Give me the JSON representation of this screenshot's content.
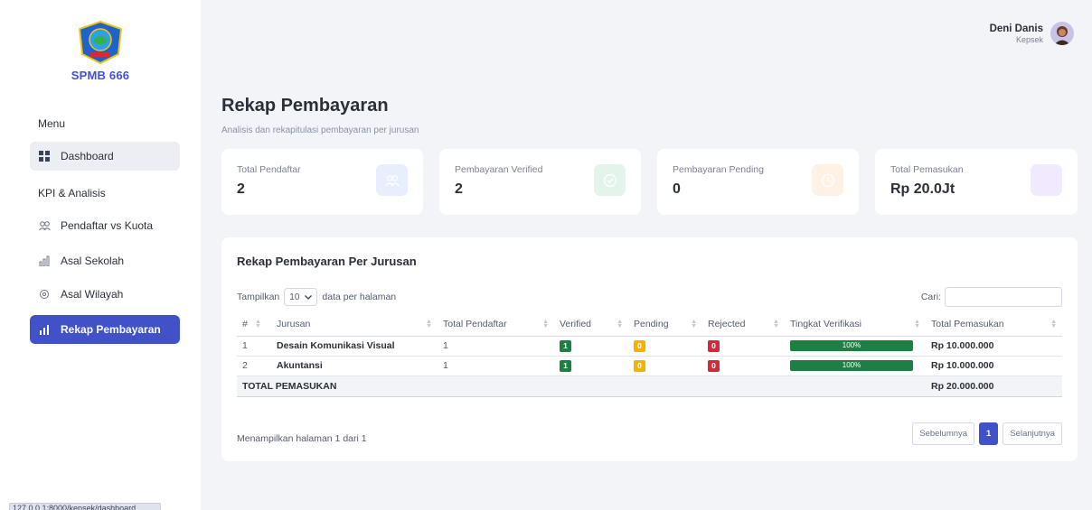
{
  "brand": {
    "name": "SPMB 666"
  },
  "sidebar": {
    "menu_heading": "Menu",
    "kpi_heading": "KPI & Analisis",
    "items": [
      {
        "label": "Dashboard",
        "icon": "grid-icon"
      },
      {
        "label": "Pendaftar vs Kuota",
        "icon": "users-icon"
      },
      {
        "label": "Asal Sekolah",
        "icon": "bar-chart-icon"
      },
      {
        "label": "Asal Wilayah",
        "icon": "map-pin-icon"
      },
      {
        "label": "Rekap Pembayaran",
        "icon": "bar-chart-icon"
      }
    ]
  },
  "status_url": "127.0.0.1:8000/kepsek/dashboard",
  "user": {
    "name": "Deni Danis",
    "role": "Kepsek"
  },
  "page": {
    "title": "Rekap Pembayaran",
    "subtitle": "Analisis dan rekapitulasi pembayaran per jurusan"
  },
  "stats": [
    {
      "label": "Total Pendaftar",
      "value": "2",
      "icon": "users-icon",
      "color": "#4a7cf0",
      "bg": "#e7eefe"
    },
    {
      "label": "Pembayaran Verified",
      "value": "2",
      "icon": "check-circle-icon",
      "color": "#34a86a",
      "bg": "#e3f5ea"
    },
    {
      "label": "Pembayaran Pending",
      "value": "0",
      "icon": "clock-icon",
      "color": "#f5a14a",
      "bg": "#fff1e3"
    },
    {
      "label": "Total Pemasukan",
      "value": "Rp 20.0Jt",
      "icon": "money-icon",
      "color": "#a07ee8",
      "bg": "#f1eafe"
    }
  ],
  "table_panel": {
    "title": "Rekap Pembayaran Per Jurusan",
    "show_prefix": "Tampilkan",
    "page_length": "10",
    "show_suffix": "data per halaman",
    "search_label": "Cari:",
    "search_value": "",
    "columns": [
      "#",
      "Jurusan",
      "Total Pendaftar",
      "Verified",
      "Pending",
      "Rejected",
      "Tingkat Verifikasi",
      "Total Pemasukan"
    ],
    "rows": [
      {
        "no": "1",
        "jurusan": "Desain Komunikasi Visual",
        "total": "1",
        "verified": "1",
        "pending": "0",
        "rejected": "0",
        "rate": 1.0,
        "rate_label": "100%",
        "pemasukan": "Rp 10.000.000"
      },
      {
        "no": "2",
        "jurusan": "Akuntansi",
        "total": "1",
        "verified": "1",
        "pending": "0",
        "rejected": "0",
        "rate": 1.0,
        "rate_label": "100%",
        "pemasukan": "Rp 10.000.000"
      }
    ],
    "total_label": "TOTAL PEMASUKAN",
    "total_value": "Rp 20.000.000",
    "info": "Menampilkan halaman 1 dari 1",
    "prev_label": "Sebelumnya",
    "current_page": "1",
    "next_label": "Selanjutnya"
  }
}
